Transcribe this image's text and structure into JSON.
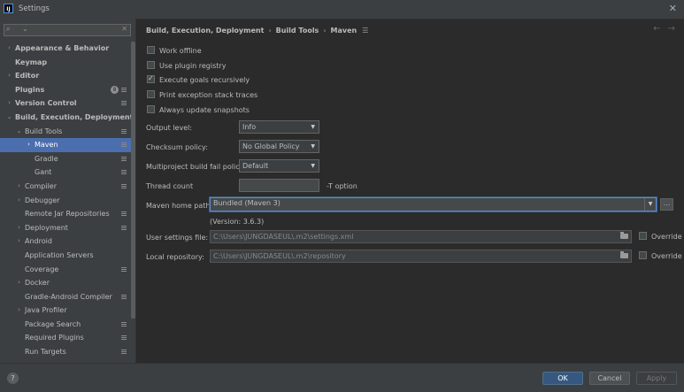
{
  "window": {
    "title": "Settings",
    "app_icon_text": "IJ"
  },
  "search": {
    "value": ""
  },
  "sidebar": {
    "items": [
      {
        "label": "Appearance & Behavior",
        "arrow": "›",
        "bold": true,
        "indent": 0,
        "mark": false
      },
      {
        "label": "Keymap",
        "arrow": "",
        "bold": true,
        "indent": 0,
        "mark": false
      },
      {
        "label": "Editor",
        "arrow": "›",
        "bold": true,
        "indent": 0,
        "mark": false
      },
      {
        "label": "Plugins",
        "arrow": "",
        "bold": true,
        "indent": 0,
        "mark": true,
        "badge": "8"
      },
      {
        "label": "Version Control",
        "arrow": "›",
        "bold": true,
        "indent": 0,
        "mark": true
      },
      {
        "label": "Build, Execution, Deployment",
        "arrow": "⌄",
        "bold": true,
        "indent": 0,
        "mark": false
      },
      {
        "label": "Build Tools",
        "arrow": "⌄",
        "bold": false,
        "indent": 1,
        "mark": true
      },
      {
        "label": "Maven",
        "arrow": "›",
        "bold": false,
        "indent": 2,
        "mark": true,
        "selected": true
      },
      {
        "label": "Gradle",
        "arrow": "",
        "bold": false,
        "indent": 2,
        "mark": true
      },
      {
        "label": "Gant",
        "arrow": "",
        "bold": false,
        "indent": 2,
        "mark": true
      },
      {
        "label": "Compiler",
        "arrow": "›",
        "bold": false,
        "indent": 1,
        "mark": true
      },
      {
        "label": "Debugger",
        "arrow": "›",
        "bold": false,
        "indent": 1,
        "mark": false
      },
      {
        "label": "Remote Jar Repositories",
        "arrow": "",
        "bold": false,
        "indent": 1,
        "mark": true
      },
      {
        "label": "Deployment",
        "arrow": "›",
        "bold": false,
        "indent": 1,
        "mark": true
      },
      {
        "label": "Android",
        "arrow": "›",
        "bold": false,
        "indent": 1,
        "mark": false
      },
      {
        "label": "Application Servers",
        "arrow": "",
        "bold": false,
        "indent": 1,
        "mark": false
      },
      {
        "label": "Coverage",
        "arrow": "",
        "bold": false,
        "indent": 1,
        "mark": true
      },
      {
        "label": "Docker",
        "arrow": "›",
        "bold": false,
        "indent": 1,
        "mark": false
      },
      {
        "label": "Gradle-Android Compiler",
        "arrow": "",
        "bold": false,
        "indent": 1,
        "mark": true
      },
      {
        "label": "Java Profiler",
        "arrow": "›",
        "bold": false,
        "indent": 1,
        "mark": false
      },
      {
        "label": "Package Search",
        "arrow": "",
        "bold": false,
        "indent": 1,
        "mark": true
      },
      {
        "label": "Required Plugins",
        "arrow": "",
        "bold": false,
        "indent": 1,
        "mark": true
      },
      {
        "label": "Run Targets",
        "arrow": "",
        "bold": false,
        "indent": 1,
        "mark": true
      }
    ]
  },
  "breadcrumb": {
    "part1": "Build, Execution, Deployment",
    "part2": "Build Tools",
    "part3": "Maven",
    "sep": "›"
  },
  "options": {
    "work_offline": "Work offline",
    "use_plugin_registry": "Use plugin registry",
    "execute_goals": "Execute goals recursively",
    "print_exception": "Print exception stack traces",
    "always_update": "Always update snapshots"
  },
  "fields": {
    "output_level_label": "Output level:",
    "output_level_value": "Info",
    "checksum_label": "Checksum policy:",
    "checksum_value": "No Global Policy",
    "multiproject_label": "Multiproject build fail policy:",
    "multiproject_value": "Default",
    "thread_count_label": "Thread count",
    "thread_count_value": "",
    "t_option": "-T option",
    "maven_home_label": "Maven home path:",
    "maven_home_value": "Bundled (Maven 3)",
    "maven_version": "(Version: 3.6.3)",
    "user_settings_label": "User settings file:",
    "user_settings_value": "C:\\Users\\JUNGDASEUL\\.m2\\settings.xml",
    "local_repo_label": "Local repository:",
    "local_repo_value": "C:\\Users\\JUNGDASEUL\\.m2\\repository",
    "override": "Override",
    "browse": "..."
  },
  "buttons": {
    "ok": "OK",
    "cancel": "Cancel",
    "apply": "Apply",
    "help": "?"
  }
}
